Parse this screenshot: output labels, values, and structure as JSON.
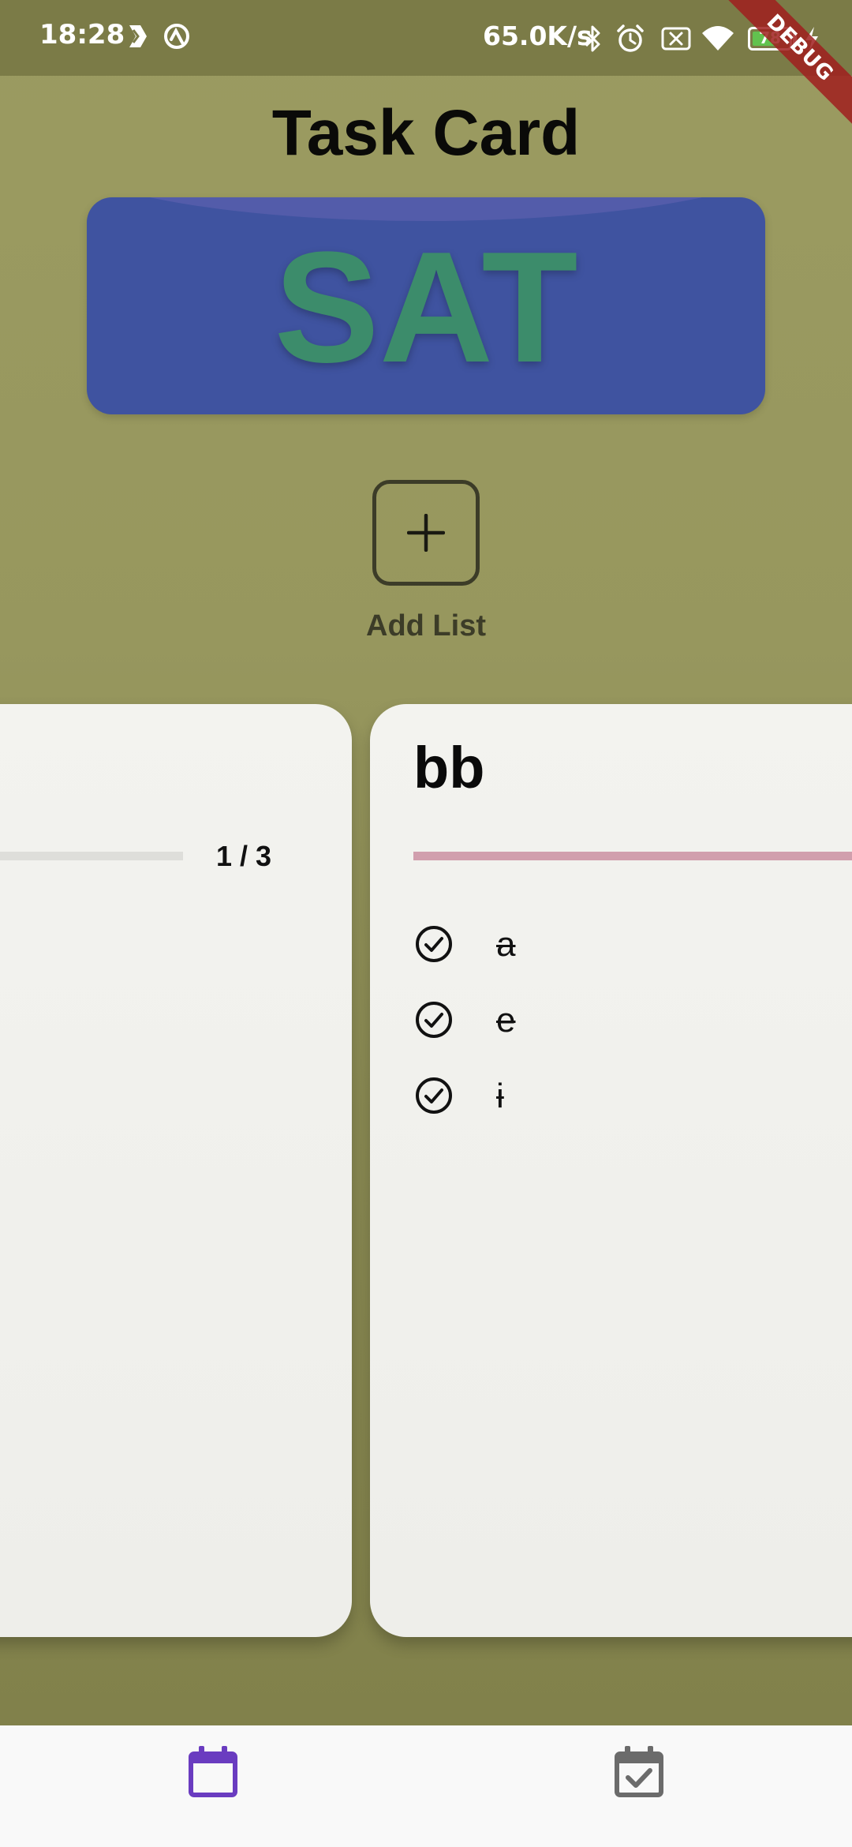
{
  "status_bar": {
    "time": "18:28",
    "network_speed": "65.0K/s",
    "battery_level": "78",
    "battery_fraction": 0.78,
    "icons": [
      "nav-diamond-icon",
      "sync-icon",
      "bluetooth-icon",
      "alarm-icon",
      "sim-disabled-icon",
      "wifi-icon",
      "battery-icon",
      "charging-icon"
    ]
  },
  "debug_banner": "DEBUG",
  "header": {
    "title": "Task Card"
  },
  "day_banner": {
    "day": "SAT",
    "background_color": "#3f53a0",
    "text_color": "#3c8c6b"
  },
  "add_list": {
    "label": "Add List",
    "icon": "plus-icon"
  },
  "cards": [
    {
      "title": "",
      "progress_label": "1 / 3",
      "progress_fraction": 0.33
    },
    {
      "title": "bb",
      "progress_color": "#d19fad",
      "tasks": [
        {
          "label": "a",
          "done": true,
          "icon": "check-circle-icon"
        },
        {
          "label": "e",
          "done": true,
          "icon": "check-circle-icon"
        },
        {
          "label": "i",
          "done": true,
          "icon": "check-circle-icon"
        }
      ]
    }
  ],
  "bottom_nav": {
    "items": [
      {
        "icon": "calendar-icon",
        "active": true,
        "color": "#6a3cc0"
      },
      {
        "icon": "calendar-check-icon",
        "active": false,
        "color": "#6b6b6b"
      }
    ]
  },
  "colors": {
    "background": "#9b9b61",
    "accent": "#6a3cc0"
  }
}
